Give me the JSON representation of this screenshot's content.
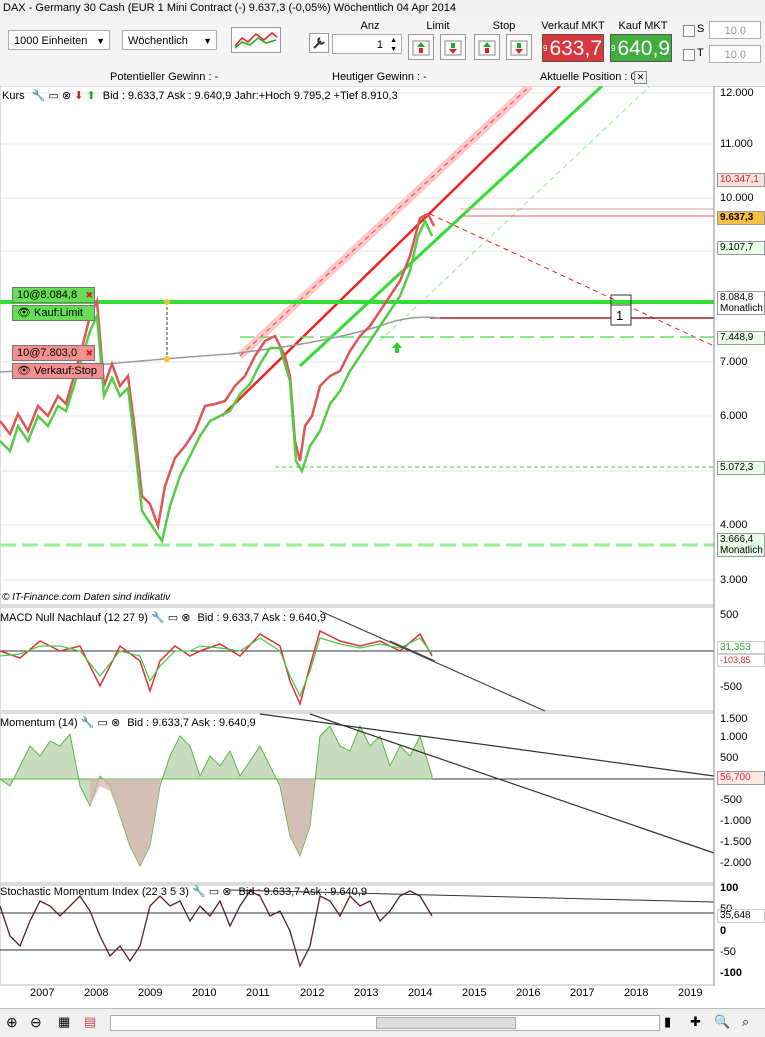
{
  "title": "DAX - Germany 30 Cash (EUR 1 Mini Contract (-)    9.637,3 (-0,05%)    Wöchentlich  04 Apr 2014",
  "toolbar": {
    "units": "1000 Einheiten",
    "period": "Wöchentlich",
    "anz_label": "Anz",
    "qty": "1",
    "limit_label": "Limit",
    "stop_label": "Stop",
    "sell_label": "Verkauf MKT",
    "buy_label": "Kauf MKT",
    "sell_prefix": "9",
    "sell_price": "633,7",
    "buy_prefix": "9",
    "buy_price": "640,9",
    "s_label": "S",
    "t_label": "T",
    "s_value": "10.0",
    "t_value": "10.0"
  },
  "summary": {
    "potential": "Potentieller Gewinn : -",
    "today": "Heutiger Gewinn : -",
    "position": "Aktuelle Position : 0"
  },
  "main_panel": {
    "header": "Kurs",
    "info": "Bid : 9.633,7 Ask : 9.640,9 Jahr:+Hoch 9.795,2 +Tief 8.910,3",
    "y_ticks": [
      "12.000",
      "11.000",
      "10.000",
      "9.000",
      "7.000",
      "6.000",
      "5.000",
      "4.000",
      "3.000"
    ],
    "price_labels": {
      "high": "10.347,1",
      "current": "9.637,3",
      "level2": "9.107,7",
      "monthly1_val": "8.084,8",
      "monthly1_lbl": "Monatlich",
      "level3": "7.448,9",
      "level4": "5.072,3",
      "monthly2_val": "3.666,4",
      "monthly2_lbl": "Monatlich"
    },
    "orders": {
      "buy_qty": "10@8.084,8",
      "buy_type": "Kauf:Limit",
      "sell_qty": "10@7.803,0",
      "sell_type": "Verkauf:Stop"
    },
    "marker": "1",
    "source": "© IT-Finance.com  Daten sind indikativ"
  },
  "macd_panel": {
    "header": "MACD Null Nachlauf (12 27 9)",
    "info": "Bid : 9.633,7 Ask : 9.640,9",
    "y_ticks": [
      "500",
      "-500"
    ],
    "val1": "31,353",
    "val2": "-103,85"
  },
  "momentum_panel": {
    "header": "Momentum (14)",
    "info": "Bid : 9.633,7 Ask : 9.640,9",
    "y_ticks": [
      "1.500",
      "1.000",
      "500",
      "-500",
      "-1.000",
      "-1.500",
      "-2.000"
    ],
    "val": "56,700"
  },
  "stoch_panel": {
    "header": "Stochastic Momentum Index (22 3 5 3)",
    "info": "Bid : 9.633,7 Ask : 9.640,9",
    "y_ticks": [
      "100",
      "50",
      "0",
      "-50",
      "-100"
    ],
    "val": "35,648"
  },
  "x_axis": [
    "2007",
    "2008",
    "2009",
    "2010",
    "2011",
    "2012",
    "2013",
    "2014",
    "2015",
    "2016",
    "2017",
    "2018",
    "2019"
  ],
  "colors": {
    "sell": "#d9363e",
    "buy": "#3fae3f",
    "green_line": "#33dd33",
    "red_line": "#ee3333"
  }
}
